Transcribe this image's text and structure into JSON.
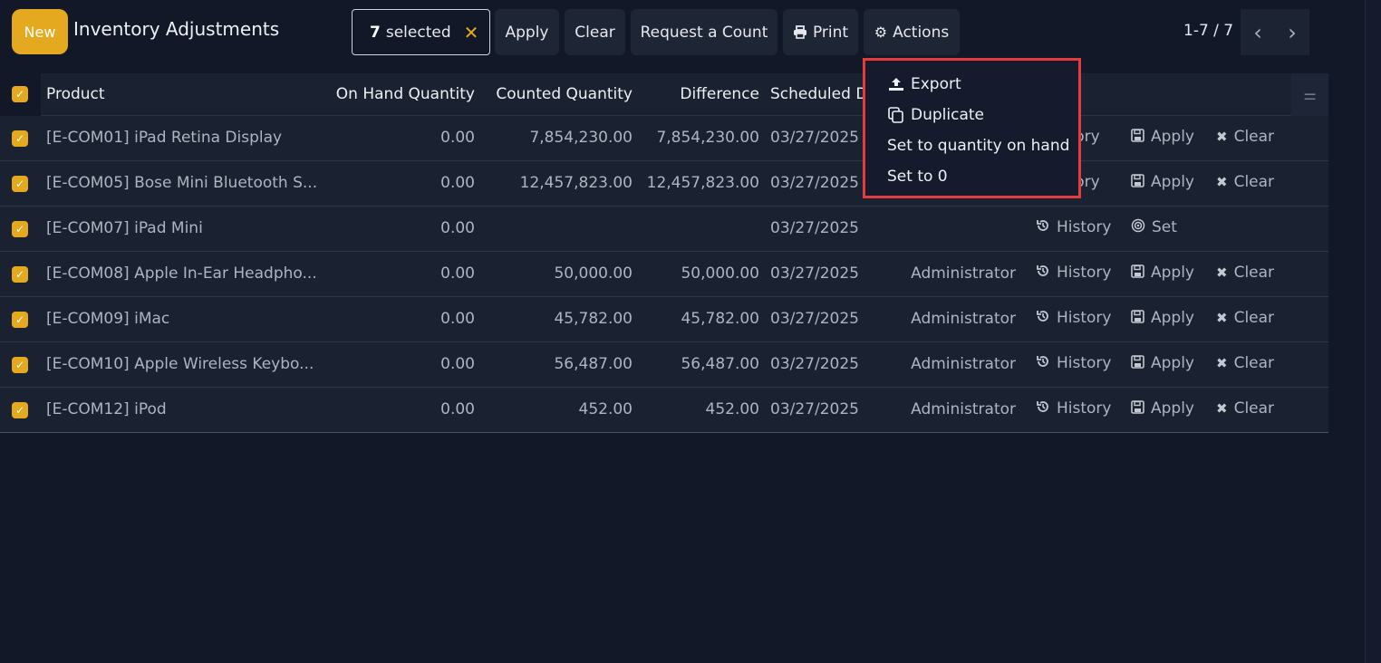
{
  "app": {
    "title": "Inventory Adjustments",
    "new_label": "New"
  },
  "selection": {
    "count": "7",
    "label": "selected",
    "clear_glyph": "✕"
  },
  "toolbar": {
    "apply": "Apply",
    "clear": "Clear",
    "request_count": "Request a Count",
    "print": "Print",
    "actions": "Actions"
  },
  "pager": {
    "text": "1-7 / 7",
    "prev": "‹",
    "next": "›"
  },
  "table": {
    "headers": {
      "product": "Product",
      "on_hand": "On Hand Quantity",
      "counted": "Counted Quantity",
      "difference": "Difference",
      "scheduled": "Scheduled D"
    },
    "rows": [
      {
        "product": "[E-COM01] iPad Retina Display",
        "on_hand": "0.00",
        "counted": "7,854,230.00",
        "difference": "7,854,230.00",
        "date": "03/27/2025",
        "user": "",
        "history": "istory",
        "apply": "Apply",
        "clear": "Clear"
      },
      {
        "product": "[E-COM05] Bose Mini Bluetooth S...",
        "on_hand": "0.00",
        "counted": "12,457,823.00",
        "difference": "12,457,823.00",
        "date": "03/27/2025",
        "user": "",
        "history": "istory",
        "apply": "Apply",
        "clear": "Clear"
      },
      {
        "product": "[E-COM07] iPad Mini",
        "on_hand": "0.00",
        "counted": "",
        "difference": "",
        "date": "03/27/2025",
        "user": "",
        "history": "History",
        "set": "Set"
      },
      {
        "product": "[E-COM08] Apple In-Ear Headpho...",
        "on_hand": "0.00",
        "counted": "50,000.00",
        "difference": "50,000.00",
        "date": "03/27/2025",
        "user": "Administrator",
        "history": "History",
        "apply": "Apply",
        "clear": "Clear"
      },
      {
        "product": "[E-COM09] iMac",
        "on_hand": "0.00",
        "counted": "45,782.00",
        "difference": "45,782.00",
        "date": "03/27/2025",
        "user": "Administrator",
        "history": "History",
        "apply": "Apply",
        "clear": "Clear"
      },
      {
        "product": "[E-COM10] Apple Wireless Keybo...",
        "on_hand": "0.00",
        "counted": "56,487.00",
        "difference": "56,487.00",
        "date": "03/27/2025",
        "user": "Administrator",
        "history": "History",
        "apply": "Apply",
        "clear": "Clear"
      },
      {
        "product": "[E-COM12] iPod",
        "on_hand": "0.00",
        "counted": "452.00",
        "difference": "452.00",
        "date": "03/27/2025",
        "user": "Administrator",
        "history": "History",
        "apply": "Apply",
        "clear": "Clear"
      }
    ]
  },
  "actions_menu": {
    "export": "Export",
    "duplicate": "Duplicate",
    "set_on_hand": "Set to quantity on hand",
    "set_zero": "Set to 0"
  },
  "colors": {
    "accent": "#e5a91f",
    "background": "#121828",
    "highlight_border": "#e53a3e"
  }
}
